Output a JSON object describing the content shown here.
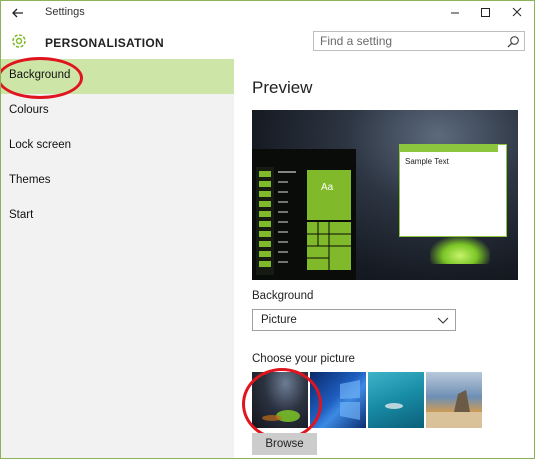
{
  "window": {
    "title": "Settings"
  },
  "header": {
    "heading": "PERSONALISATION",
    "search_placeholder": "Find a setting"
  },
  "sidebar": {
    "items": [
      {
        "label": "Background",
        "active": true
      },
      {
        "label": "Colours"
      },
      {
        "label": "Lock screen"
      },
      {
        "label": "Themes"
      },
      {
        "label": "Start"
      }
    ]
  },
  "main": {
    "preview_title": "Preview",
    "preview": {
      "sample_text": "Sample Text",
      "tile_text": "Aa"
    },
    "background_label": "Background",
    "background_value": "Picture",
    "choose_label": "Choose your picture",
    "browse_label": "Browse"
  },
  "colors": {
    "accent": "#80b929",
    "active_nav": "#cde6a7",
    "annotation": "#e0141e"
  },
  "icons": [
    "back-arrow-icon",
    "minimize-icon",
    "maximize-icon",
    "close-icon",
    "gear-icon",
    "search-icon",
    "chevron-down-icon"
  ]
}
